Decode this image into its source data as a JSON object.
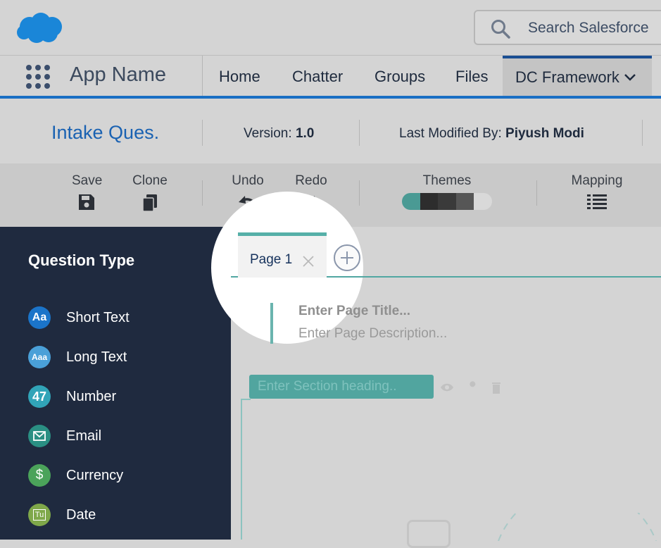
{
  "header": {
    "search_placeholder": "Search Salesforce"
  },
  "nav": {
    "app_name": "App Name",
    "items": [
      {
        "label": "Home"
      },
      {
        "label": "Chatter"
      },
      {
        "label": "Groups"
      },
      {
        "label": "Files"
      },
      {
        "label": "DC Framework"
      }
    ]
  },
  "info": {
    "title": "Intake Ques.",
    "version_label": "Version:",
    "version_value": "1.0",
    "modified_label": "Last Modified By:",
    "modified_value": "Piyush Modi"
  },
  "toolbar": {
    "save": "Save",
    "clone": "Clone",
    "undo": "Undo",
    "redo": "Redo",
    "themes": "Themes",
    "mapping": "Mapping",
    "theme_colors": [
      "#4a9a94",
      "#2d2d2d",
      "#3a3a3a",
      "#565656",
      "#d9d9d9"
    ]
  },
  "sidebar": {
    "title": "Question Type",
    "items": [
      {
        "label": "Short Text",
        "icon": "Aa",
        "color": "#1b74c9"
      },
      {
        "label": "Long Text",
        "icon": "Aaa",
        "color": "#4aa0d8"
      },
      {
        "label": "Number",
        "icon": "47",
        "color": "#31a4b8"
      },
      {
        "label": "Email",
        "icon": "email-icon",
        "color": "#2a8f83"
      },
      {
        "label": "Currency",
        "icon": "$",
        "color": "#4ba35a"
      },
      {
        "label": "Date",
        "icon": "Tu",
        "color": "#7fa84a"
      }
    ]
  },
  "canvas": {
    "tab_label": "Page 1",
    "page_title_placeholder": "Enter Page Title...",
    "page_desc_placeholder": "Enter Page Description...",
    "section_placeholder": "Enter Section heading.."
  }
}
